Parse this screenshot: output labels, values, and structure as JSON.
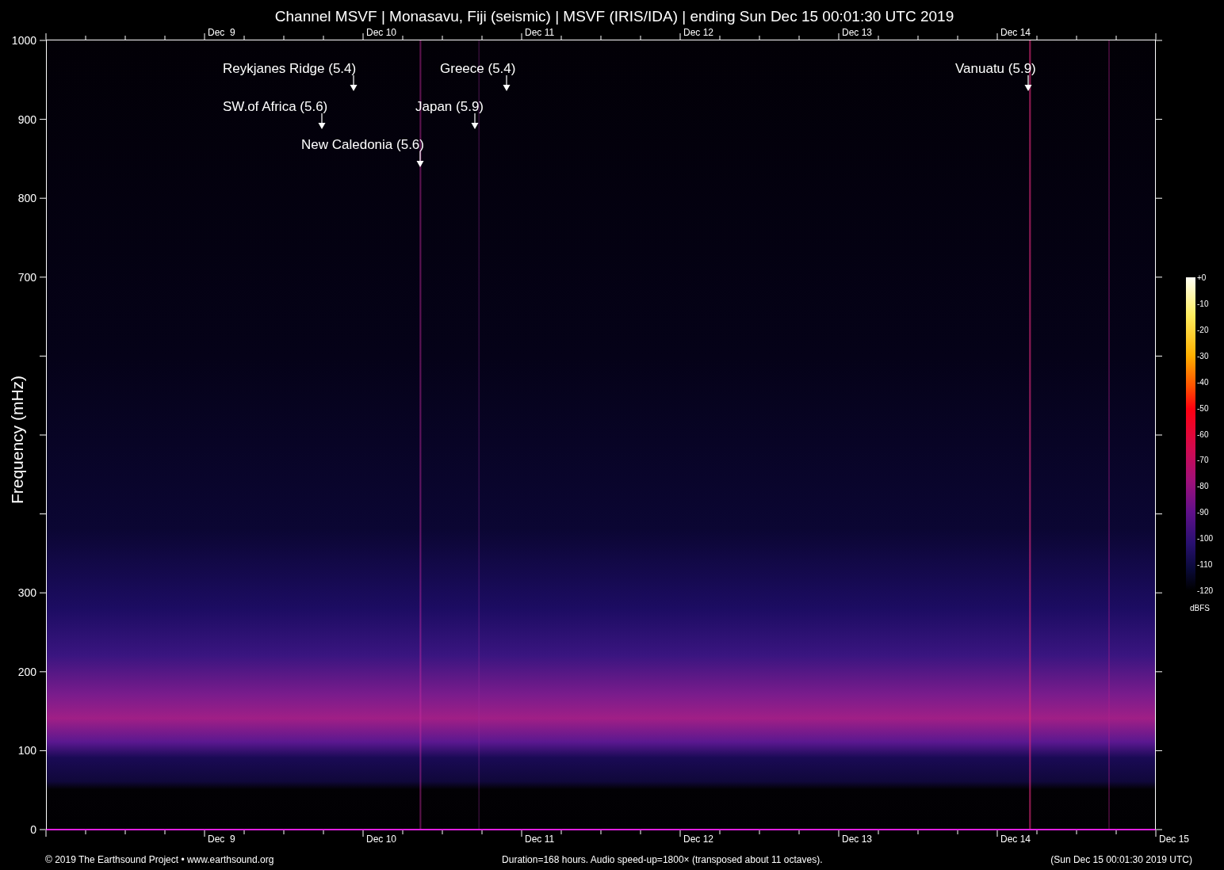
{
  "title": "Channel MSVF | Monasavu, Fiji (seismic) | MSVF (IRIS/IDA) | ending Sun Dec 15 00:01:30 UTC 2019",
  "top_date_labels": [
    "Dec  9",
    "Dec 10",
    "Dec 11",
    "Dec 12",
    "Dec 13",
    "Dec 14"
  ],
  "bottom_date_labels": [
    "Dec  9",
    "Dec 10",
    "Dec 11",
    "Dec 12",
    "Dec 13",
    "Dec 14",
    "Dec 15"
  ],
  "y_axis": {
    "title": "Frequency (mHz)",
    "tick_labels": [
      "1000",
      "900",
      "800",
      "700",
      "300",
      "200",
      "100",
      "0"
    ]
  },
  "annotations": [
    {
      "label": "Reykjanes Ridge (5.4)"
    },
    {
      "label": "SW.of Africa (5.6)"
    },
    {
      "label": "New Caledonia (5.6)"
    },
    {
      "label": "Greece (5.4)"
    },
    {
      "label": "Japan (5.9)"
    },
    {
      "label": "Vanuatu (5.9)"
    }
  ],
  "colorbar": {
    "tick_labels": [
      "+0",
      "-10",
      "-20",
      "-30",
      "-40",
      "-50",
      "-60",
      "-70",
      "-80",
      "-90",
      "-100",
      "-110",
      "-120"
    ],
    "unit": "dBFS"
  },
  "footer": {
    "credit": "© 2019 The Earthsound Project • www.earthsound.org",
    "info": "Duration=168 hours. Audio speed-up=1800× (transposed about 11 octaves).",
    "end_time": "(Sun Dec 15 00:01:30 2019 UTC)"
  }
}
